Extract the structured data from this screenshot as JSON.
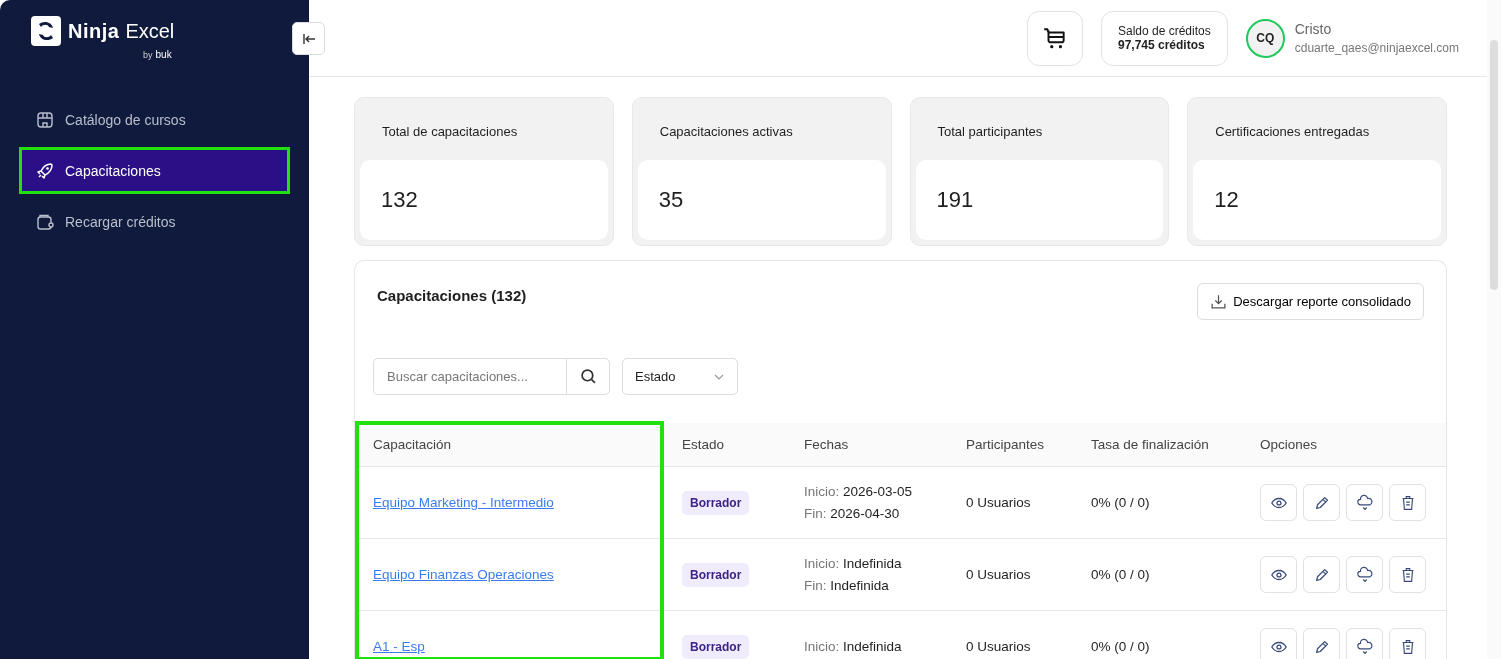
{
  "sidebar": {
    "brand": {
      "name_bold": "Ninja",
      "name_light": "Excel",
      "by": "by",
      "sub_brand": "buk"
    },
    "items": [
      {
        "label": "Catálogo de cursos",
        "selected": false,
        "highlighted": false
      },
      {
        "label": "Capacitaciones",
        "selected": true,
        "highlighted": true
      },
      {
        "label": "Recargar créditos",
        "selected": false,
        "highlighted": false
      }
    ]
  },
  "header": {
    "credits": {
      "label": "Saldo de créditos",
      "value": "97,745 créditos"
    },
    "user": {
      "initials": "CQ",
      "name": "Cristo",
      "email": "cduarte_qaes@ninjaexcel.com"
    }
  },
  "stats": [
    {
      "label": "Total de capacitaciones",
      "value": "132"
    },
    {
      "label": "Capacitaciones activas",
      "value": "35"
    },
    {
      "label": "Total participantes",
      "value": "191"
    },
    {
      "label": "Certificaciones entregadas",
      "value": "12"
    }
  ],
  "panel": {
    "title": "Capacitaciones (132)",
    "download_button": "Descargar reporte consolidado",
    "search": {
      "placeholder": "Buscar capacitaciones..."
    },
    "status_filter": "Estado",
    "table": {
      "columns": [
        {
          "label": "Capacitación",
          "highlighted": true
        },
        {
          "label": "Estado",
          "highlighted": false
        },
        {
          "label": "Fechas",
          "highlighted": false
        },
        {
          "label": "Participantes",
          "highlighted": false
        },
        {
          "label": "Tasa de finalización",
          "highlighted": false
        },
        {
          "label": "Opciones",
          "highlighted": false
        }
      ],
      "rows": [
        {
          "name": "Equipo Marketing - Intermedio",
          "status": "Borrador",
          "start_label": "Inicio:",
          "start": "2026-03-05",
          "end_label": "Fin:",
          "end": "2026-04-30",
          "participants": "0 Usuarios",
          "completion": "0% (0 / 0)"
        },
        {
          "name": "Equipo Finanzas Operaciones",
          "status": "Borrador",
          "start_label": "Inicio:",
          "start": "Indefinida",
          "end_label": "Fin:",
          "end": "Indefinida",
          "participants": "0 Usuarios",
          "completion": "0% (0 / 0)"
        },
        {
          "name": "A1 - Esp",
          "status": "Borrador",
          "start_label": "Inicio:",
          "start": "Indefinida",
          "participants": "0 Usuarios",
          "completion": "0% (0 / 0)"
        }
      ]
    }
  }
}
